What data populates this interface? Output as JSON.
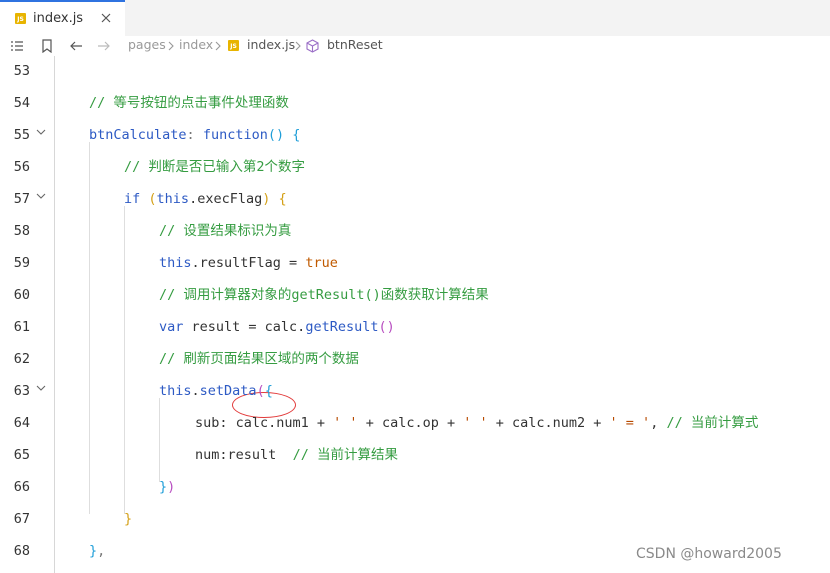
{
  "tab": {
    "badge": "JS",
    "label": "index.js"
  },
  "breadcrumb": {
    "items": [
      "pages",
      "index",
      "index.js",
      "btnReset"
    ]
  },
  "editor": {
    "line_numbers": [
      "53",
      "54",
      "55",
      "56",
      "57",
      "58",
      "59",
      "60",
      "61",
      "62",
      "63",
      "64",
      "65",
      "66",
      "67",
      "68"
    ],
    "folded_lines": [
      "55",
      "57",
      "63"
    ],
    "lines": [
      [],
      [
        {
          "t": "// 等号按钮的点击事件处理函数",
          "c": "cmt"
        }
      ],
      [
        {
          "t": "btnCalculate",
          "c": "kw"
        },
        {
          "t": ": ",
          "c": "punc"
        },
        {
          "t": "function",
          "c": "kw"
        },
        {
          "t": "(",
          "c": "paren3"
        },
        {
          "t": ")",
          "c": "paren3"
        },
        {
          "t": " {",
          "c": "paren3"
        }
      ],
      [
        {
          "t": "// 判断是否已输入第2个数字",
          "c": "cmt"
        }
      ],
      [
        {
          "t": "if",
          "c": "kw"
        },
        {
          "t": " ",
          "c": "punc"
        },
        {
          "t": "(",
          "c": "paren1"
        },
        {
          "t": "this",
          "c": "kw"
        },
        {
          "t": ".execFlag",
          "c": "prop"
        },
        {
          "t": ")",
          "c": "paren1"
        },
        {
          "t": " {",
          "c": "paren1"
        }
      ],
      [
        {
          "t": "// 设置结果标识为真",
          "c": "cmt"
        }
      ],
      [
        {
          "t": "this",
          "c": "kw"
        },
        {
          "t": ".resultFlag = ",
          "c": "prop"
        },
        {
          "t": "true",
          "c": "lit"
        }
      ],
      [
        {
          "t": "// 调用计算器对象的getResult()函数获取计算结果",
          "c": "cmt"
        }
      ],
      [
        {
          "t": "var",
          "c": "kw"
        },
        {
          "t": " result = calc.",
          "c": "prop"
        },
        {
          "t": "getResult",
          "c": "fn"
        },
        {
          "t": "()",
          "c": "paren2"
        }
      ],
      [
        {
          "t": "// 刷新页面结果区域的两个数据",
          "c": "cmt"
        }
      ],
      [
        {
          "t": "this",
          "c": "kw"
        },
        {
          "t": ".",
          "c": "prop"
        },
        {
          "t": "setData",
          "c": "fn"
        },
        {
          "t": "(",
          "c": "paren2"
        },
        {
          "t": "{",
          "c": "paren3"
        }
      ],
      [
        {
          "t": "sub: calc.num1 + ",
          "c": "prop"
        },
        {
          "t": "' '",
          "c": "str"
        },
        {
          "t": " + calc.op + ",
          "c": "prop"
        },
        {
          "t": "' '",
          "c": "str"
        },
        {
          "t": " + calc.num2 + ",
          "c": "prop"
        },
        {
          "t": "' = '",
          "c": "str"
        },
        {
          "t": ", ",
          "c": "prop"
        },
        {
          "t": "// 当前计算式",
          "c": "cmt"
        }
      ],
      [
        {
          "t": "num:",
          "c": "prop"
        },
        {
          "t": "result",
          "c": "prop"
        },
        {
          "t": "  ",
          "c": "prop"
        },
        {
          "t": "// 当前计算结果",
          "c": "cmt"
        }
      ],
      [
        {
          "t": "}",
          "c": "paren3"
        },
        {
          "t": ")",
          "c": "paren2"
        }
      ],
      [
        {
          "t": "}",
          "c": "paren1"
        }
      ],
      [
        {
          "t": "}",
          "c": "paren3"
        },
        {
          "t": ",",
          "c": "punc"
        }
      ]
    ]
  },
  "watermark": "CSDN @howard2005",
  "colors": {
    "comment": "#359c41",
    "keyword": "#2d5ac4",
    "string": "#b74a00",
    "tab_accent": "#2f73e0",
    "highlight_ellipse": "#e23b3b"
  }
}
